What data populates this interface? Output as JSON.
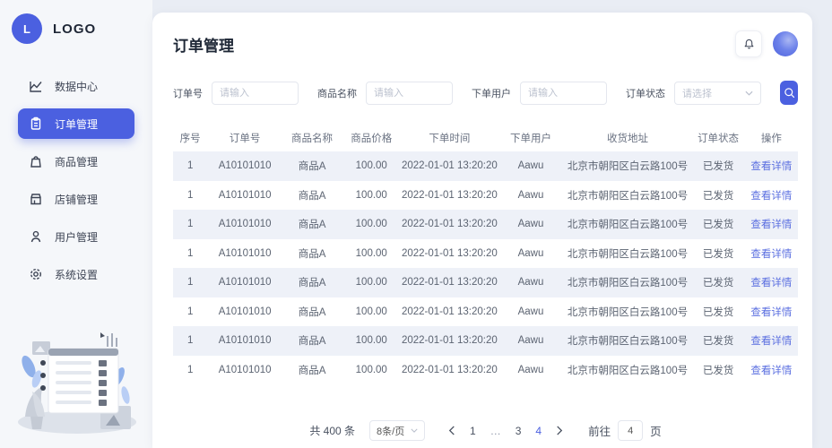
{
  "brand": {
    "logo_letter": "L",
    "logo_text": "LOGO"
  },
  "sidebar": {
    "items": [
      {
        "label": "数据中心",
        "icon": "chart-icon",
        "active": false
      },
      {
        "label": "订单管理",
        "icon": "clipboard-icon",
        "active": true
      },
      {
        "label": "商品管理",
        "icon": "bag-icon",
        "active": false
      },
      {
        "label": "店铺管理",
        "icon": "store-icon",
        "active": false
      },
      {
        "label": "用户管理",
        "icon": "user-icon",
        "active": false
      },
      {
        "label": "系统设置",
        "icon": "gear-icon",
        "active": false
      }
    ]
  },
  "header": {
    "title": "订单管理"
  },
  "filters": [
    {
      "label": "订单号",
      "placeholder": "请输入",
      "type": "input"
    },
    {
      "label": "商品名称",
      "placeholder": "请输入",
      "type": "input"
    },
    {
      "label": "下单用户",
      "placeholder": "请输入",
      "type": "input"
    },
    {
      "label": "订单状态",
      "placeholder": "请选择",
      "type": "select"
    }
  ],
  "table": {
    "columns": [
      "序号",
      "订单号",
      "商品名称",
      "商品价格",
      "下单时间",
      "下单用户",
      "收货地址",
      "订单状态",
      "操作"
    ],
    "rows": [
      {
        "cells": [
          "1",
          "A10101010",
          "商品A",
          "100.00",
          "2022-01-01 13:20:20",
          "Aawu",
          "北京市朝阳区白云路100号",
          "已发货"
        ],
        "action": "查看详情"
      },
      {
        "cells": [
          "1",
          "A10101010",
          "商品A",
          "100.00",
          "2022-01-01 13:20:20",
          "Aawu",
          "北京市朝阳区白云路100号",
          "已发货"
        ],
        "action": "查看详情"
      },
      {
        "cells": [
          "1",
          "A10101010",
          "商品A",
          "100.00",
          "2022-01-01 13:20:20",
          "Aawu",
          "北京市朝阳区白云路100号",
          "已发货"
        ],
        "action": "查看详情"
      },
      {
        "cells": [
          "1",
          "A10101010",
          "商品A",
          "100.00",
          "2022-01-01 13:20:20",
          "Aawu",
          "北京市朝阳区白云路100号",
          "已发货"
        ],
        "action": "查看详情"
      },
      {
        "cells": [
          "1",
          "A10101010",
          "商品A",
          "100.00",
          "2022-01-01 13:20:20",
          "Aawu",
          "北京市朝阳区白云路100号",
          "已发货"
        ],
        "action": "查看详情"
      },
      {
        "cells": [
          "1",
          "A10101010",
          "商品A",
          "100.00",
          "2022-01-01 13:20:20",
          "Aawu",
          "北京市朝阳区白云路100号",
          "已发货"
        ],
        "action": "查看详情"
      },
      {
        "cells": [
          "1",
          "A10101010",
          "商品A",
          "100.00",
          "2022-01-01 13:20:20",
          "Aawu",
          "北京市朝阳区白云路100号",
          "已发货"
        ],
        "action": "查看详情"
      },
      {
        "cells": [
          "1",
          "A10101010",
          "商品A",
          "100.00",
          "2022-01-01 13:20:20",
          "Aawu",
          "北京市朝阳区白云路100号",
          "已发货"
        ],
        "action": "查看详情"
      }
    ]
  },
  "pagination": {
    "total_text": "共 400 条",
    "page_size": "8条/页",
    "pages": [
      "1",
      "…",
      "3",
      "4"
    ],
    "current_page": "4",
    "jump_label": "前往",
    "jump_value": "4",
    "jump_suffix": "页"
  },
  "colors": {
    "primary": "#4b60e0",
    "link": "#5b6fe0",
    "stripe_row": "#eef1f8",
    "page_background": "#e9edf4",
    "sidebar_background": "#f5f7fa"
  }
}
